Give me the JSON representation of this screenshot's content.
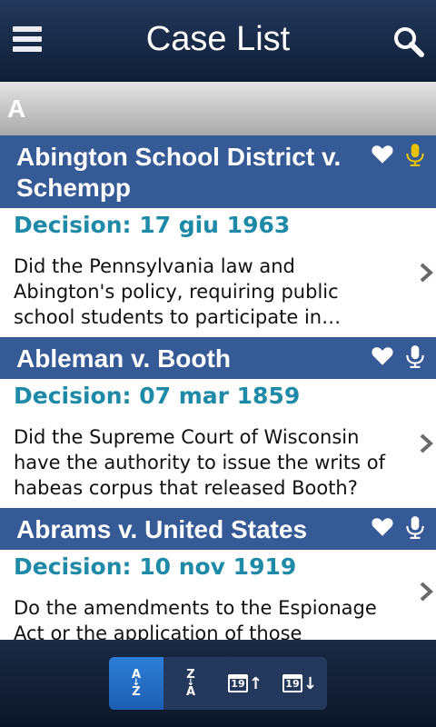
{
  "header": {
    "title": "Case List",
    "menu_icon": "hamburger-menu-icon",
    "search_icon": "search-icon"
  },
  "section": {
    "letter": "A"
  },
  "cases": [
    {
      "title": "Abington School District v. Schempp",
      "decision": "Decision: 17 giu 1963",
      "summary": "Did the Pennsylvania law and Abington's policy, requiring public school students to participate in…",
      "favorite": true,
      "audio_highlighted": true
    },
    {
      "title": "Ableman v. Booth",
      "decision": "Decision: 07 mar 1859",
      "summary": "Did the Supreme Court of Wisconsin have the authority to issue the writs of habeas corpus that released Booth?",
      "favorite": true,
      "audio_highlighted": false
    },
    {
      "title": "Abrams v. United States",
      "decision": "Decision: 10 nov 1919",
      "summary": "Do the amendments to the Espionage Act or the application of those",
      "favorite": true,
      "audio_highlighted": false
    }
  ],
  "sort_bar": {
    "az": {
      "top": "A",
      "bottom": "Z"
    },
    "za": {
      "top": "Z",
      "bottom": "A"
    },
    "date_asc_day": "19",
    "date_desc_day": "19",
    "active": "az"
  },
  "colors": {
    "header_bg": "#1a2b48",
    "case_title_bar": "#365a96",
    "decision_text": "#1f8aa8",
    "audio_highlight": "#e6c200",
    "active_sort": "#2a74cc"
  }
}
